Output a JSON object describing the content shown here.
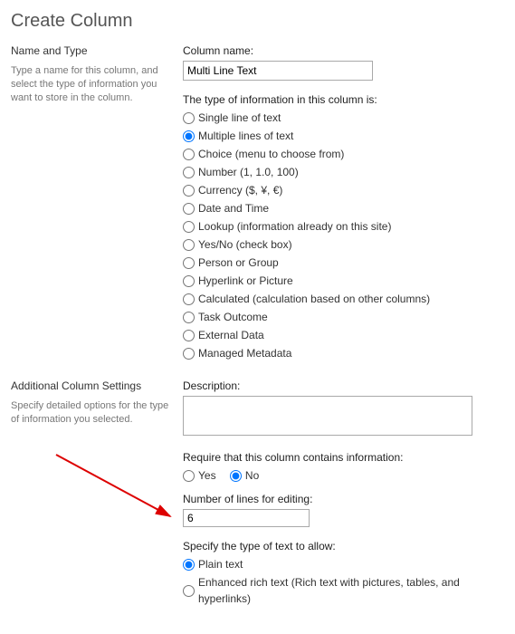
{
  "page_title": "Create Column",
  "nameAndType": {
    "heading": "Name and Type",
    "help": "Type a name for this column, and select the type of information you want to store in the column.",
    "columnNameLabel": "Column name:",
    "columnNameValue": "Multi Line Text",
    "typeLabel": "The type of information in this column is:",
    "options": [
      "Single line of text",
      "Multiple lines of text",
      "Choice (menu to choose from)",
      "Number (1, 1.0, 100)",
      "Currency ($, ¥, €)",
      "Date and Time",
      "Lookup (information already on this site)",
      "Yes/No (check box)",
      "Person or Group",
      "Hyperlink or Picture",
      "Calculated (calculation based on other columns)",
      "Task Outcome",
      "External Data",
      "Managed Metadata"
    ],
    "selected": "Multiple lines of text"
  },
  "additional": {
    "heading": "Additional Column Settings",
    "help": "Specify detailed options for the type of information you selected.",
    "descriptionLabel": "Description:",
    "descriptionValue": "",
    "requireLabel": "Require that this column contains information:",
    "requireYes": "Yes",
    "requireNo": "No",
    "requireSelected": "No",
    "numLinesLabel": "Number of lines for editing:",
    "numLinesValue": "6",
    "textTypeLabel": "Specify the type of text to allow:",
    "textTypePlain": "Plain text",
    "textTypeRich": "Enhanced rich text (Rich text with pictures, tables, and hyperlinks)",
    "textTypeSelected": "Plain text"
  }
}
